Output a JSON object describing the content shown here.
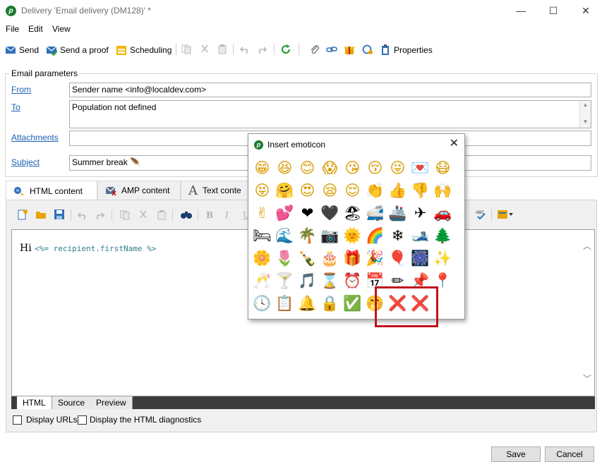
{
  "window": {
    "title": "Delivery 'Email delivery (DM128)' *",
    "app_icon_glyph": "p",
    "minimize_glyph": "—",
    "maximize_glyph": "☐",
    "close_glyph": "✕"
  },
  "menu": [
    "File",
    "Edit",
    "View"
  ],
  "toolbar": {
    "send": "Send",
    "send_proof": "Send a proof",
    "scheduling": "Scheduling",
    "properties": "Properties"
  },
  "email_params": {
    "legend": "Email parameters",
    "from_label": "From",
    "from_value": "Sender name <info@localdev.com>",
    "to_label": "To",
    "to_value": "Population not defined",
    "attachments_label": "Attachments",
    "attachments_value": "",
    "subject_label": "Subject",
    "subject_value": "Summer break 🪶"
  },
  "tabs": {
    "html": "HTML content",
    "amp": "AMP content",
    "text": "Text conte"
  },
  "editor": {
    "greeting": "Hi",
    "code": "<%= recipient.firstName %>",
    "bold": "B",
    "italic": "I",
    "under": "U"
  },
  "sub_tabs": [
    "HTML",
    "Source",
    "Preview"
  ],
  "options": {
    "display_urls": "Display URLs",
    "display_diag": "Display the HTML diagnostics"
  },
  "buttons": {
    "save": "Save",
    "cancel": "Cancel"
  },
  "dialog": {
    "title": "Insert emoticon",
    "close_glyph": "✕",
    "emoticons": [
      {
        "g": "😁",
        "n": "grin-emoticon",
        "face": true
      },
      {
        "g": "😆",
        "n": "laugh-emoticon",
        "face": true
      },
      {
        "g": "😊",
        "n": "smile-emoticon",
        "face": true
      },
      {
        "g": "😱",
        "n": "scream-emoticon",
        "face": true
      },
      {
        "g": "😘",
        "n": "kiss-emoticon",
        "face": true
      },
      {
        "g": "😚",
        "n": "kiss-closed-eyes-emoticon",
        "face": true
      },
      {
        "g": "😜",
        "n": "wink-tongue-emoticon",
        "face": true
      },
      {
        "g": "💌",
        "n": "love-letter-emoticon",
        "face": false
      },
      {
        "g": "😷",
        "n": "mask-emoticon",
        "face": true
      },
      {
        "g": "😝",
        "n": "squint-tongue-emoticon",
        "face": true
      },
      {
        "g": "🤗",
        "n": "hug-emoticon",
        "face": true
      },
      {
        "g": "😍",
        "n": "heart-eyes-emoticon",
        "face": true
      },
      {
        "g": "😪",
        "n": "sleepy-emoticon",
        "face": true
      },
      {
        "g": "😌",
        "n": "relieved-emoticon",
        "face": true
      },
      {
        "g": "👏",
        "n": "clap-emoticon",
        "face": true
      },
      {
        "g": "👍",
        "n": "thumbs-up-emoticon",
        "face": true
      },
      {
        "g": "👎",
        "n": "thumbs-down-emoticon",
        "face": true
      },
      {
        "g": "🙌",
        "n": "raised-hands-emoticon",
        "face": true
      },
      {
        "g": "✌",
        "n": "victory-emoticon",
        "face": true
      },
      {
        "g": "💕",
        "n": "two-hearts-emoticon",
        "face": false
      },
      {
        "g": "❤",
        "n": "red-heart-emoticon",
        "face": false
      },
      {
        "g": "🖤",
        "n": "black-heart-emoticon",
        "face": false
      },
      {
        "g": "🏖",
        "n": "beach-emoticon",
        "face": false
      },
      {
        "g": "🚅",
        "n": "train-emoticon",
        "face": false
      },
      {
        "g": "🚢",
        "n": "ship-emoticon",
        "face": false
      },
      {
        "g": "✈",
        "n": "airplane-emoticon",
        "face": false
      },
      {
        "g": "🚗",
        "n": "car-emoticon",
        "face": false
      },
      {
        "g": "🛏",
        "n": "bed-emoticon",
        "face": false
      },
      {
        "g": "🌊",
        "n": "wave-emoticon",
        "face": false
      },
      {
        "g": "🌴",
        "n": "palm-tree-emoticon",
        "face": false
      },
      {
        "g": "📷",
        "n": "camera-emoticon",
        "face": false
      },
      {
        "g": "🌞",
        "n": "sun-emoticon",
        "face": true
      },
      {
        "g": "🌈",
        "n": "rainbow-emoticon",
        "face": false
      },
      {
        "g": "❄",
        "n": "snowflake-emoticon",
        "face": false
      },
      {
        "g": "🎿",
        "n": "ski-emoticon",
        "face": false
      },
      {
        "g": "🌲",
        "n": "tree-emoticon",
        "face": false
      },
      {
        "g": "🌼",
        "n": "flower-emoticon",
        "face": false
      },
      {
        "g": "🌷",
        "n": "tulip-emoticon",
        "face": false
      },
      {
        "g": "🍾",
        "n": "champagne-bottle-emoticon",
        "face": false
      },
      {
        "g": "🎂",
        "n": "cake-emoticon",
        "face": false
      },
      {
        "g": "🎁",
        "n": "gift-emoticon",
        "face": false
      },
      {
        "g": "🎉",
        "n": "party-popper-emoticon",
        "face": false
      },
      {
        "g": "🎈",
        "n": "balloon-emoticon",
        "face": false
      },
      {
        "g": "🎆",
        "n": "fireworks-emoticon",
        "face": false
      },
      {
        "g": "✨",
        "n": "sparkles-emoticon",
        "face": false
      },
      {
        "g": "🥂",
        "n": "toast-emoticon",
        "face": false
      },
      {
        "g": "🍸",
        "n": "cocktail-emoticon",
        "face": false
      },
      {
        "g": "🎵",
        "n": "music-note-emoticon",
        "face": false
      },
      {
        "g": "⌛",
        "n": "hourglass-emoticon",
        "face": false
      },
      {
        "g": "⏰",
        "n": "alarm-clock-emoticon",
        "face": false
      },
      {
        "g": "📅",
        "n": "calendar-emoticon",
        "face": false
      },
      {
        "g": "✏",
        "n": "pencil-emoticon",
        "face": false
      },
      {
        "g": "📌",
        "n": "pushpin-emoticon",
        "face": false
      },
      {
        "g": "📍",
        "n": "round-pin-emoticon",
        "face": false
      },
      {
        "g": "🕓",
        "n": "clock-emoticon",
        "face": false
      },
      {
        "g": "📋",
        "n": "clipboard-emoticon",
        "face": false
      },
      {
        "g": "🔔",
        "n": "bell-emoticon",
        "face": false
      },
      {
        "g": "🔒",
        "n": "lock-emoticon",
        "face": false
      },
      {
        "g": "✅",
        "n": "check-mark-emoticon",
        "face": false
      },
      {
        "g": "🤭",
        "n": "hand-over-mouth-emoticon",
        "face": true
      },
      {
        "g": "❌",
        "n": "cross-mark-emoticon",
        "face": false
      },
      {
        "g": "❌",
        "n": "cross-mark-emoticon-2",
        "face": false
      }
    ]
  },
  "colors": {
    "link": "#1a5fb4",
    "highlight_box": "#c0121e",
    "code_text": "#2e7d8c",
    "green_accent": "#1c7a2e"
  }
}
